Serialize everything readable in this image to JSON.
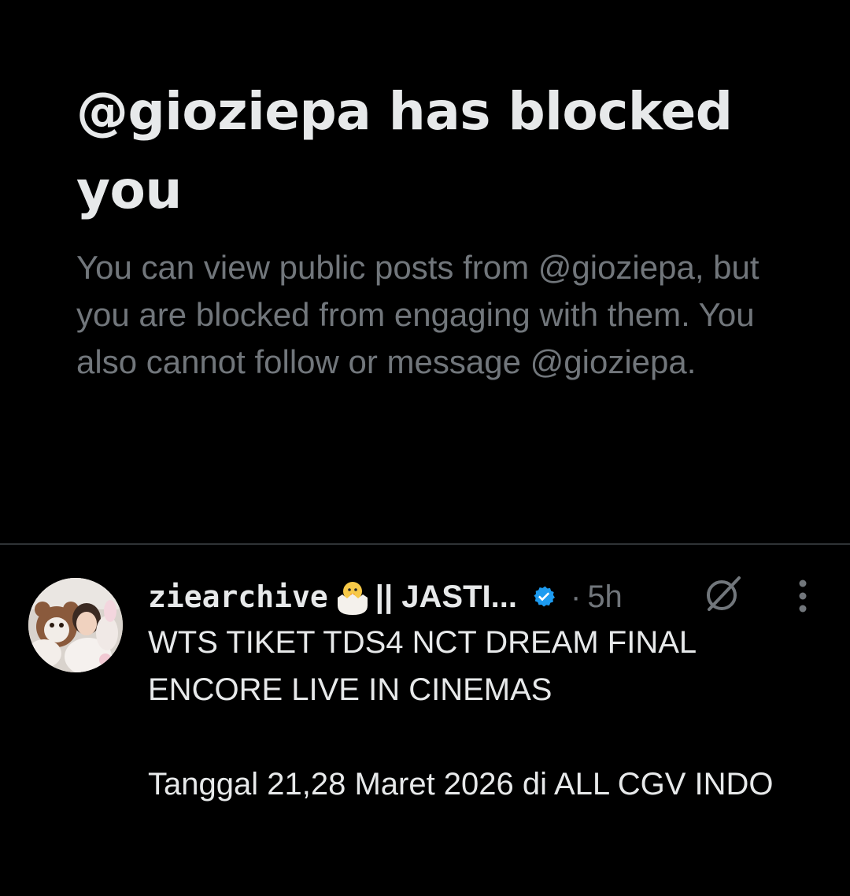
{
  "blocked_notice": {
    "title": "@gioziepa has blocked you",
    "body": "You can view public posts from @gioziepa, but you are blocked from engaging with them. You also cannot follow or message @gioziepa."
  },
  "post": {
    "author_name": "ziearchive",
    "author_emoji": "hatching-chick-emoji",
    "author_name_suffix": "|| JASTI...",
    "verified": true,
    "separator": "·",
    "time": "5h",
    "text_line_1": "WTS TIKET TDS4 NCT DREAM FINAL ENCORE LIVE IN CINEMAS",
    "text_line_2": "Tanggal 21,28 Maret 2026 di ALL CGV INDO"
  },
  "icons": {
    "grok": "grok-icon",
    "more": "more-vertical-icon",
    "verified": "verified-badge-icon"
  },
  "colors": {
    "background": "#000000",
    "primary_text": "#e7e9ea",
    "secondary_text": "#71767b",
    "divider": "#2f3336",
    "verified_blue": "#1d9bf0"
  }
}
